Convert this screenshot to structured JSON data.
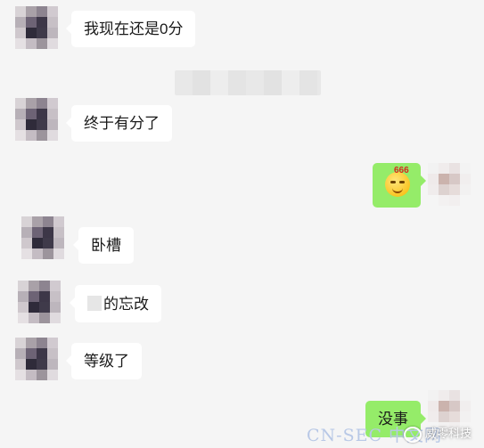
{
  "chat": {
    "messages": [
      {
        "side": "left",
        "text": "我现在还是0分"
      },
      {
        "side": "left",
        "text": "终于有分了"
      },
      {
        "side": "right",
        "sticker": "666-emoji"
      },
      {
        "side": "left",
        "text": "卧槽"
      },
      {
        "side": "left",
        "text": "的忘改"
      },
      {
        "side": "left",
        "text": "等级了"
      },
      {
        "side": "right",
        "text": "没事"
      }
    ]
  },
  "sticker": {
    "text": "666"
  },
  "watermark": {
    "text": "威零科技"
  },
  "source_mark": {
    "text": "CN-SEC 中文网"
  },
  "colors": {
    "background": "#f5f5f5",
    "bubble_left": "#ffffff",
    "bubble_right": "#95ec69"
  }
}
